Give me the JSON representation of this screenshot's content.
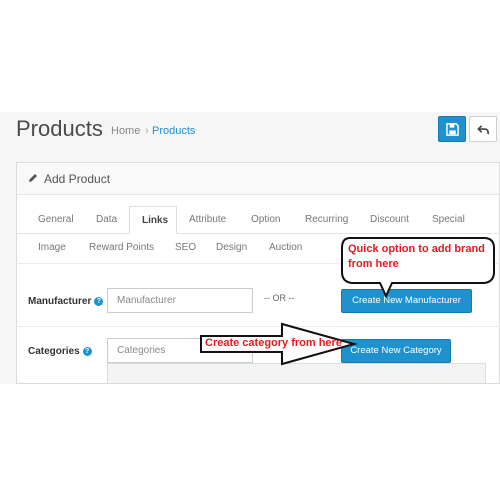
{
  "header": {
    "title": "Products",
    "breadcrumb": {
      "home": "Home",
      "separator": "›",
      "current": "Products"
    }
  },
  "panel": {
    "title": "Add Product",
    "tabs": [
      "General",
      "Data",
      "Links",
      "Attribute",
      "Option",
      "Recurring",
      "Discount",
      "Special",
      "Image",
      "Reward Points",
      "SEO",
      "Design",
      "Auction"
    ],
    "active_tab": "Links"
  },
  "form": {
    "manufacturer": {
      "label": "Manufacturer",
      "placeholder": "Manufacturer",
      "or_text": "-- OR --",
      "button": "Create New Manufacturer"
    },
    "categories": {
      "label": "Categories",
      "placeholder": "Categories",
      "button": "Create New Category"
    }
  },
  "annotations": {
    "bubble": "Quick option to add brand from here",
    "arrow": "Create category from here"
  },
  "colors": {
    "primary": "#1e91cf",
    "annotation": "#e8191e"
  },
  "icons": {
    "save": "save-icon",
    "back": "back-icon",
    "edit": "pencil-icon",
    "help": "question-circle-icon"
  }
}
